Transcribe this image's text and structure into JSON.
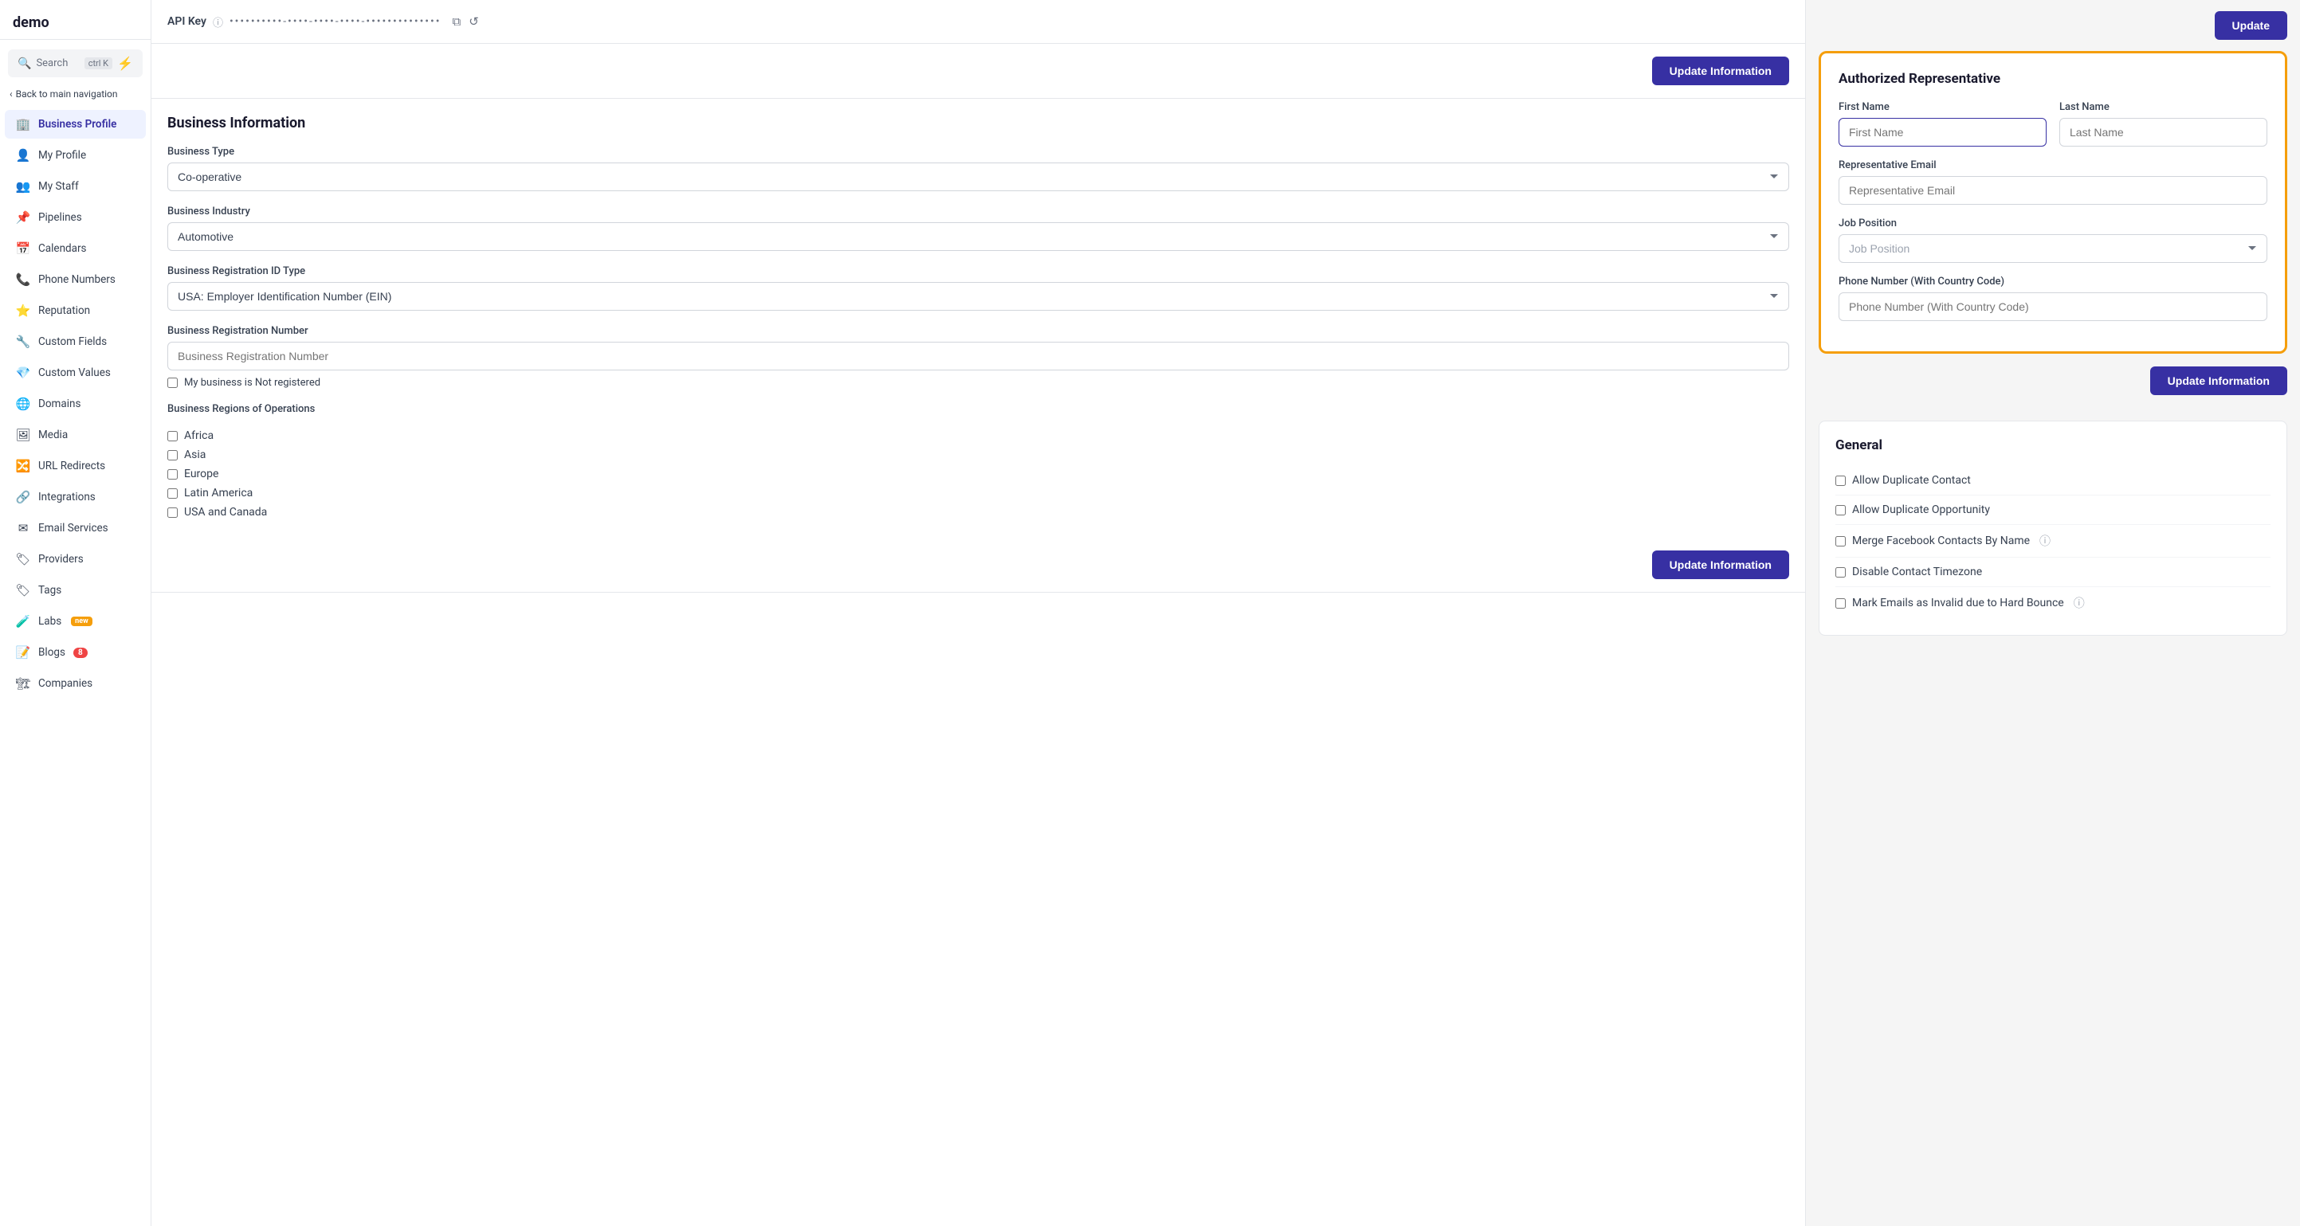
{
  "app": {
    "logo": "demo",
    "search_label": "Search",
    "search_kbd": "ctrl K",
    "back_nav": "Back to main navigation"
  },
  "sidebar": {
    "items": [
      {
        "id": "business-profile",
        "label": "Business Profile",
        "icon": "🏢",
        "active": true
      },
      {
        "id": "my-profile",
        "label": "My Profile",
        "icon": "👤"
      },
      {
        "id": "my-staff",
        "label": "My Staff",
        "icon": "👥"
      },
      {
        "id": "pipelines",
        "label": "Pipelines",
        "icon": "📌"
      },
      {
        "id": "calendars",
        "label": "Calendars",
        "icon": "📅"
      },
      {
        "id": "phone-numbers",
        "label": "Phone Numbers",
        "icon": "📞"
      },
      {
        "id": "reputation",
        "label": "Reputation",
        "icon": "⭐"
      },
      {
        "id": "custom-fields",
        "label": "Custom Fields",
        "icon": "🔧"
      },
      {
        "id": "custom-values",
        "label": "Custom Values",
        "icon": "💎"
      },
      {
        "id": "domains",
        "label": "Domains",
        "icon": "🌐"
      },
      {
        "id": "media",
        "label": "Media",
        "icon": "🖼"
      },
      {
        "id": "url-redirects",
        "label": "URL Redirects",
        "icon": "🔀"
      },
      {
        "id": "integrations",
        "label": "Integrations",
        "icon": "🔗"
      },
      {
        "id": "email-services",
        "label": "Email Services",
        "icon": "✉"
      },
      {
        "id": "providers",
        "label": "Providers",
        "icon": "🏷"
      },
      {
        "id": "tags",
        "label": "Tags",
        "icon": "🏷"
      },
      {
        "id": "labs",
        "label": "Labs",
        "icon": "🧪",
        "badge": "new"
      },
      {
        "id": "blogs",
        "label": "Blogs",
        "icon": "📝",
        "notification": "8"
      },
      {
        "id": "companies",
        "label": "Companies",
        "icon": "🏗"
      }
    ]
  },
  "left_panel": {
    "api_key_label": "API Key",
    "api_key_value": "••••••••••-••••-••••-••••-••••••••••••••",
    "update_information_btn_1": "Update Information",
    "business_info_title": "Business Information",
    "business_type_label": "Business Type",
    "business_type_value": "Co-operative",
    "business_industry_label": "Business Industry",
    "business_industry_value": "Automotive",
    "business_reg_id_label": "Business Registration ID Type",
    "business_reg_id_value": "USA: Employer Identification Number (EIN)",
    "business_reg_num_label": "Business Registration Number",
    "business_reg_num_placeholder": "Business Registration Number",
    "not_registered_label": "My business is Not registered",
    "regions_label": "Business Regions of Operations",
    "regions": [
      "Africa",
      "Asia",
      "Europe",
      "Latin America",
      "USA and Canada"
    ],
    "update_information_btn_2": "Update Information"
  },
  "right_panel": {
    "update_btn": "Update",
    "auth_rep_title": "Authorized Representative",
    "first_name_label": "First Name",
    "first_name_placeholder": "First Name",
    "last_name_label": "Last Name",
    "last_name_placeholder": "Last Name",
    "rep_email_label": "Representative Email",
    "rep_email_placeholder": "Representative Email",
    "job_position_label": "Job Position",
    "job_position_placeholder": "Job Position",
    "phone_label": "Phone Number (With Country Code)",
    "phone_placeholder": "Phone Number (With Country Code)",
    "update_information_btn": "Update Information",
    "general_title": "General",
    "general_items": [
      {
        "label": "Allow Duplicate Contact",
        "has_info": false
      },
      {
        "label": "Allow Duplicate Opportunity",
        "has_info": false
      },
      {
        "label": "Merge Facebook Contacts By Name",
        "has_info": true
      },
      {
        "label": "Disable Contact Timezone",
        "has_info": false
      },
      {
        "label": "Mark Emails as Invalid due to Hard Bounce",
        "has_info": true
      }
    ]
  }
}
